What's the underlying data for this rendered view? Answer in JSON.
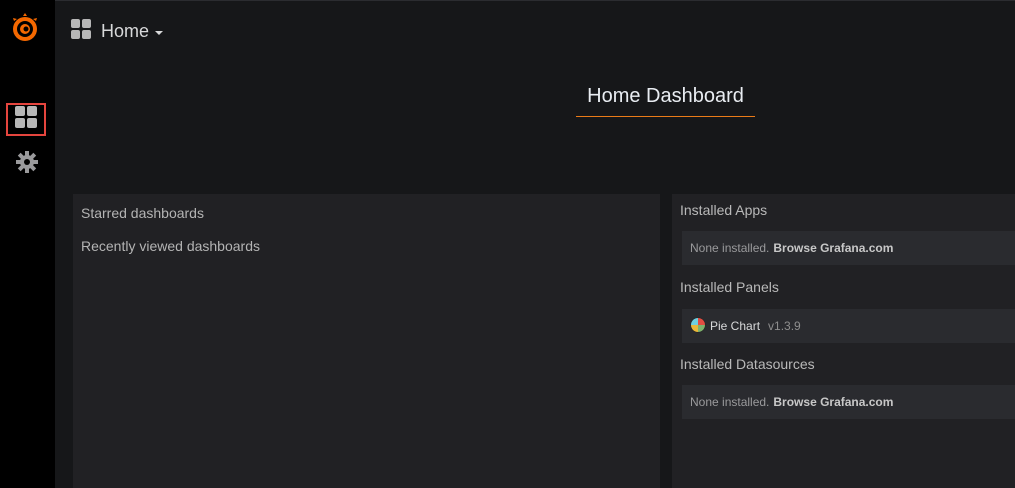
{
  "sidebar": {
    "logo": "grafana-logo",
    "items": [
      {
        "icon": "dashboards-icon",
        "selected": true
      },
      {
        "icon": "gear-icon",
        "selected": false
      }
    ]
  },
  "topbar": {
    "title": "Home"
  },
  "dashboard": {
    "title": "Home Dashboard"
  },
  "left_panel": {
    "starred_label": "Starred dashboards",
    "recent_label": "Recently viewed dashboards"
  },
  "right_panel": {
    "apps": {
      "title": "Installed Apps",
      "empty_text": "None installed.",
      "link": "Browse Grafana.com"
    },
    "panels": {
      "title": "Installed Panels",
      "items": [
        {
          "name": "Pie Chart",
          "version": "v1.3.9",
          "icon": "pie-chart-icon"
        }
      ]
    },
    "datasources": {
      "title": "Installed Datasources",
      "empty_text": "None installed.",
      "link": "Browse Grafana.com"
    }
  },
  "colors": {
    "accent": "#eb7b18",
    "highlight_box": "#e5453e",
    "sidebar_bg": "#000000",
    "panel_bg": "#212124"
  }
}
